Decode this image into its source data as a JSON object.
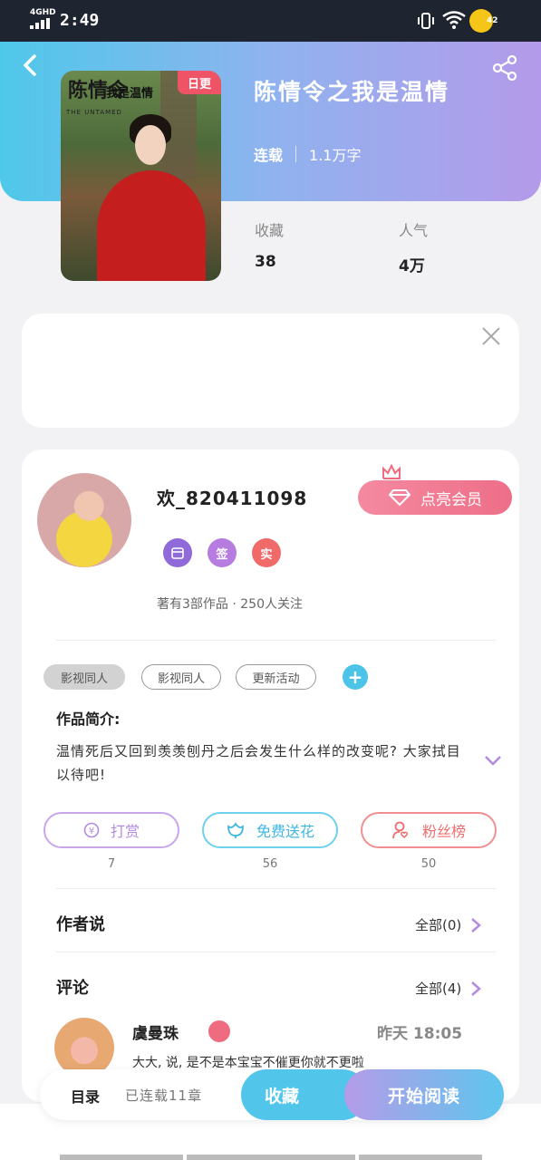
{
  "status_bar": {
    "network": "4GHD",
    "time": "2:49",
    "battery": "42"
  },
  "book": {
    "cover_logo": "陈情令",
    "cover_title": "我是温情",
    "cover_subtitle": "THE UNTAMED",
    "update_tag": "日更",
    "title": "陈情令之我是温情",
    "status": "连载",
    "word_count": "1.1万字",
    "stats": [
      {
        "label": "收藏",
        "value": "38"
      },
      {
        "label": "人气",
        "value": "4万"
      }
    ]
  },
  "author": {
    "name": "欢_820411098",
    "vip_button": "点亮会员",
    "badges": [
      {
        "text": "签",
        "color": "#b77ce0"
      },
      {
        "text": "实",
        "color": "#f06a6a"
      }
    ],
    "stats": "著有3部作品 · 250人关注"
  },
  "tags": [
    "影视同人",
    "影视同人",
    "更新活动"
  ],
  "intro": {
    "title": "作品简介:",
    "text": "温情死后又回到羡羡刨丹之后会发生什么样的改变呢? 大家拭目以待吧!"
  },
  "actions": [
    {
      "label": "打赏",
      "count": "7",
      "color": "#b48be0"
    },
    {
      "label": "免费送花",
      "count": "56",
      "color": "#4ec3e8"
    },
    {
      "label": "粉丝榜",
      "count": "50",
      "color": "#ee6e6e"
    }
  ],
  "author_says": {
    "title": "作者说",
    "more": "全部(0)"
  },
  "comments": {
    "title": "评论",
    "more": "全部(4)",
    "first": {
      "name": "虞曼珠",
      "time": "昨天 18:05",
      "text": "大大, 说, 是不是本宝宝不催更你就不更啦"
    }
  },
  "bottom": {
    "toc": "目录",
    "chapters": "已连载11章",
    "favorite": "收藏",
    "read": "开始阅读"
  },
  "colors": {
    "accent_blue": "#52c5ea",
    "accent_purple": "#b49aea",
    "tag_red": "#ef5466"
  }
}
